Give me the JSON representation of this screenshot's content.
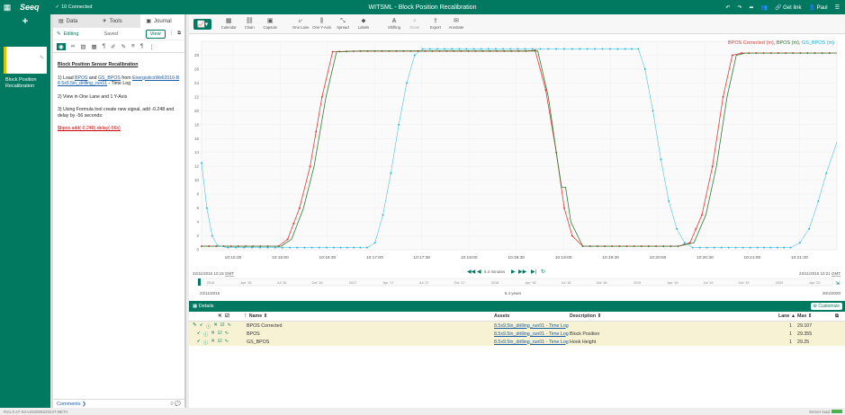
{
  "app": {
    "logo": "Seeq",
    "connections": "10 Connected",
    "title": "WITSML - Block Position Recalibration",
    "user": "Paul",
    "get_link": "Get link"
  },
  "colors": {
    "brand": "#007960",
    "series_bpos_corrected": "#e53935",
    "series_bpos": "#2e7d32",
    "series_gs_bpos": "#29b6d9",
    "row_highlight": "#f7f2d4"
  },
  "leftrail": {
    "add_icon": "+",
    "worksheet_label": "Block Position Recalibration"
  },
  "journal": {
    "tabs": [
      "Data",
      "Tools",
      "Journal"
    ],
    "mode": "Editing",
    "status": "Saved",
    "view_button": "View",
    "heading": "Block Position Sensor Recalibration",
    "step1_prefix": "1) Load ",
    "step1_bpos": "BPOS",
    "step1_and": " and ",
    "step1_gsbpos": "GS_BPOS",
    "step1_from": " from ",
    "step1_source": "EnergisticsWell2016-B",
    "step1_log": "8.5x9.5in_drilling_run01",
    "step1_suffix": " - Time Log",
    "step2": "2) View in One Lane and 1 Y-Axis",
    "step3": "3) Using Formula tool create new signal, add -0.248 and delay by -56 seconds:",
    "formula": "$bpos.add(-0.248).delay(-56s)",
    "comments": "Comments",
    "comment_count": "0"
  },
  "toolbar": {
    "items": [
      "Calendar",
      "Chain",
      "Capsule",
      "One Lane",
      "One Y-Axis",
      "Spread",
      "Labels",
      "Shifting",
      "Zoom",
      "Export",
      "Annotate"
    ]
  },
  "chart_data": {
    "type": "line",
    "legend": "BPOS Corrected (m), BPOS (m), GS_BPOS (m)",
    "xlabel": "",
    "ylabel": "",
    "ylim": [
      0,
      30
    ],
    "yticks": [
      0,
      2,
      4,
      6,
      8,
      10,
      12,
      14,
      16,
      18,
      20,
      22,
      24,
      26,
      28
    ],
    "xlim": [
      0,
      48
    ],
    "xticks": [
      "10:15:30",
      "10:16:00",
      "10:16:30",
      "10:17:00",
      "10:17:30",
      "10:18:00",
      "10:18:30",
      "10:19:00",
      "10:19:30",
      "10:20:00",
      "10:20:30",
      "10:21:00",
      "10:21:30"
    ],
    "series": [
      {
        "name": "BPOS Corrected",
        "style": "dots-line",
        "points": [
          [
            0,
            0.5
          ],
          [
            5,
            0.5
          ],
          [
            5.8,
            0.5
          ],
          [
            6.5,
            1.5
          ],
          [
            7.4,
            6
          ],
          [
            8.2,
            12
          ],
          [
            9.1,
            22
          ],
          [
            9.9,
            28.5
          ],
          [
            12,
            28.6
          ],
          [
            24.5,
            28.6
          ],
          [
            25.2,
            28.7
          ],
          [
            26,
            23
          ],
          [
            26.8,
            14
          ],
          [
            27.4,
            6
          ],
          [
            28,
            2
          ],
          [
            28.8,
            0.5
          ],
          [
            36,
            0.5
          ],
          [
            36.9,
            1
          ],
          [
            37.8,
            5
          ],
          [
            38.6,
            12
          ],
          [
            39.4,
            22
          ],
          [
            40.1,
            28
          ],
          [
            40.8,
            28.3
          ],
          [
            48,
            28.3
          ]
        ]
      },
      {
        "name": "BPOS",
        "style": "line",
        "points": [
          [
            0,
            0.5
          ],
          [
            5,
            0.5
          ],
          [
            6,
            0.5
          ],
          [
            6.8,
            1.5
          ],
          [
            7.7,
            6
          ],
          [
            8.5,
            12
          ],
          [
            9.4,
            22
          ],
          [
            10.2,
            28.5
          ],
          [
            12,
            28.6
          ],
          [
            24.6,
            28.6
          ],
          [
            25.4,
            28.6
          ],
          [
            26.2,
            22
          ],
          [
            26.8,
            14
          ],
          [
            27.2,
            9
          ],
          [
            27.5,
            9
          ],
          [
            27.9,
            4
          ],
          [
            28.8,
            0.5
          ],
          [
            36,
            0.5
          ],
          [
            37.2,
            1
          ],
          [
            38.1,
            5
          ],
          [
            38.9,
            12
          ],
          [
            39.7,
            22
          ],
          [
            40.4,
            28
          ],
          [
            41.1,
            28.3
          ],
          [
            48,
            28.3
          ]
        ]
      },
      {
        "name": "GS_BPOS",
        "style": "dots",
        "points": [
          [
            0,
            12.5
          ],
          [
            0.4,
            6
          ],
          [
            0.8,
            2
          ],
          [
            1.2,
            0.6
          ],
          [
            2,
            0.3
          ],
          [
            5,
            0.3
          ],
          [
            10,
            0.3
          ],
          [
            12.5,
            0.3
          ],
          [
            13.1,
            1
          ],
          [
            13.7,
            5
          ],
          [
            14.3,
            11
          ],
          [
            14.9,
            18
          ],
          [
            15.5,
            24
          ],
          [
            16.1,
            28
          ],
          [
            16.7,
            28.9
          ],
          [
            25,
            28.9
          ],
          [
            28,
            28.9
          ],
          [
            32,
            28.9
          ],
          [
            33,
            28.9
          ],
          [
            33.5,
            26
          ],
          [
            34.1,
            20
          ],
          [
            34.7,
            13
          ],
          [
            35.3,
            7
          ],
          [
            35.9,
            3
          ],
          [
            36.5,
            1
          ],
          [
            37.1,
            0.3
          ],
          [
            42,
            0.3
          ],
          [
            44.5,
            0.3
          ],
          [
            45.2,
            1
          ],
          [
            45.9,
            3
          ],
          [
            46.6,
            7
          ],
          [
            47.2,
            11
          ],
          [
            48,
            15.5
          ]
        ]
      }
    ]
  },
  "range": {
    "start": "22/11/2015 10:15",
    "start_tz": "GMT",
    "end": "22/11/2015 10:21",
    "end_tz": "GMT",
    "duration": "6.4 minutes",
    "overview_start": "22/11/2015",
    "overview_duration": "6.4 years",
    "overview_end": "30/4/2020",
    "overview_ticks": [
      "2016",
      "Apr '16",
      "Jul '16",
      "Oct '16",
      "2017",
      "Apr '17",
      "Jul '17",
      "Oct '17",
      "2018",
      "Apr '18",
      "Jul '18",
      "Oct '18",
      "2019",
      "Apr '19",
      "Jul '19",
      "Oct '19",
      "2020",
      "Apr '20"
    ]
  },
  "details": {
    "title": "Details",
    "customize": "Customize",
    "columns": [
      "Name",
      "Assets",
      "Description",
      "Lane",
      "Max"
    ],
    "rows": [
      {
        "name": "BPOS Corrected",
        "asset": "8.5x9.5in_drilling_run01 - Time Log",
        "description": "",
        "lane": "1",
        "max": "29.107"
      },
      {
        "name": "BPOS",
        "asset": "8.5x9.5in_drilling_run01 - Time Log",
        "description": "Block Position",
        "lane": "1",
        "max": "29.355"
      },
      {
        "name": "GS_BPOS",
        "asset": "8.5x9.5in_drilling_run01 - Time Log",
        "description": "Hook Height",
        "lane": "1",
        "max": "29.25"
      }
    ]
  },
  "status": {
    "version": "R21.0.47-03-v202005220247-BETA",
    "server_load": "Server load"
  }
}
